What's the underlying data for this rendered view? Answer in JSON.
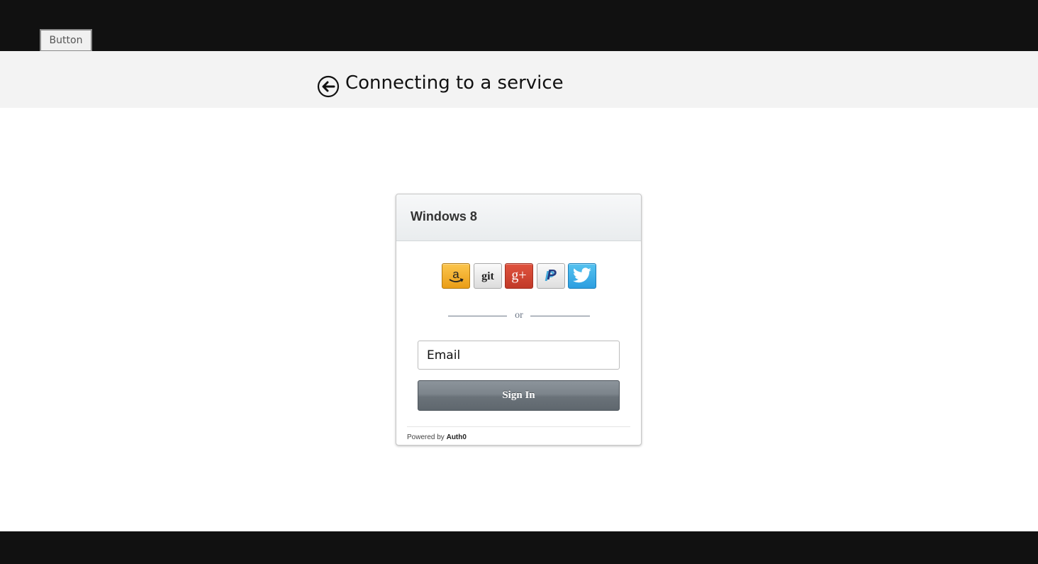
{
  "top_bar": {
    "button_label": "Button"
  },
  "header": {
    "title": "Connecting to a service"
  },
  "login": {
    "title": "Windows 8",
    "social": [
      {
        "name": "amazon",
        "label": "a"
      },
      {
        "name": "github",
        "label": "git"
      },
      {
        "name": "google-plus",
        "label": "g+"
      },
      {
        "name": "paypal",
        "label": "P"
      },
      {
        "name": "twitter",
        "label": ""
      }
    ],
    "divider_text": "or",
    "email_placeholder": "Email",
    "sign_in_label": "Sign In",
    "powered_by_prefix": "Powered by",
    "powered_by_brand": "Auth0"
  },
  "colors": {
    "top_bar": "#111111",
    "header_bg": "#f3f3f3",
    "amazon": "#f2a32a",
    "google_plus": "#d14836",
    "twitter": "#3fb0e8",
    "sign_in": "#6f777e"
  }
}
